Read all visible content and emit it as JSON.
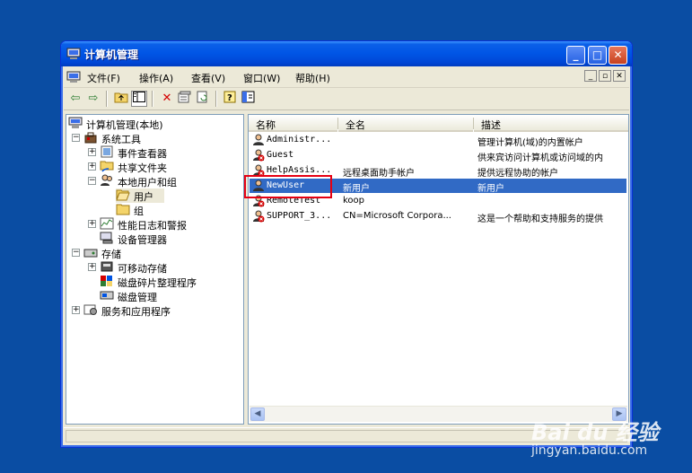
{
  "window": {
    "title": "计算机管理"
  },
  "menu": [
    "文件(F)",
    "操作(A)",
    "查看(V)",
    "窗口(W)",
    "帮助(H)"
  ],
  "tree": {
    "root": "计算机管理(本地)",
    "system_tools": "系统工具",
    "event_viewer": "事件查看器",
    "shared_folders": "共享文件夹",
    "local_users_groups": "本地用户和组",
    "users": "用户",
    "groups": "组",
    "perf_logs": "性能日志和警报",
    "device_manager": "设备管理器",
    "storage": "存储",
    "removable_storage": "可移动存储",
    "defrag": "磁盘碎片整理程序",
    "disk_mgmt": "磁盘管理",
    "services_apps": "服务和应用程序"
  },
  "list": {
    "columns": [
      "名称",
      "全名",
      "描述"
    ],
    "rows": [
      {
        "name": "Administr...",
        "fullname": "",
        "desc": "管理计算机(域)的内置帐户",
        "disabled": false
      },
      {
        "name": "Guest",
        "fullname": "",
        "desc": "供来宾访问计算机或访问域的内",
        "disabled": true
      },
      {
        "name": "HelpAssis...",
        "fullname": "远程桌面助手帐户",
        "desc": "提供远程协助的帐户",
        "disabled": true
      },
      {
        "name": "NewUser",
        "fullname": "新用户",
        "desc": "新用户",
        "disabled": false
      },
      {
        "name": "RemoteTest",
        "fullname": "koop",
        "desc": "",
        "disabled": true
      },
      {
        "name": "SUPPORT_3...",
        "fullname": "CN=Microsoft Corpora...",
        "desc": "这是一个帮助和支持服务的提供",
        "disabled": true
      }
    ]
  },
  "watermark": {
    "brand": "Bai du 经验",
    "url": "jingyan.baidu.com"
  },
  "colors": {
    "desktop": "#0a4da3",
    "selection": "#316ac5",
    "highlight_box": "#e60012"
  }
}
